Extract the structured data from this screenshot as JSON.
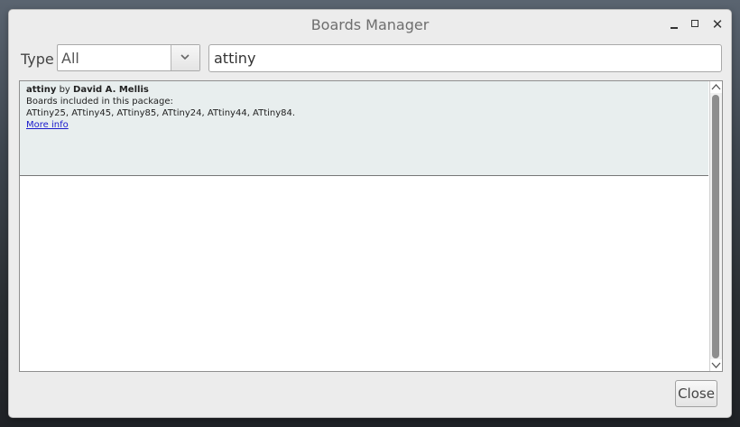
{
  "window": {
    "title": "Boards Manager"
  },
  "filter": {
    "type_label": "Type",
    "type_value": "All",
    "search_value": "attiny"
  },
  "results": [
    {
      "name": "attiny",
      "by_text": "by",
      "author": "David A. Mellis",
      "boards_heading": "Boards included in this package:",
      "boards": "ATtiny25, ATtiny45, ATtiny85, ATtiny24, ATtiny44, ATtiny84.",
      "more_info": "More info"
    }
  ],
  "footer": {
    "close_label": "Close"
  },
  "colors": {
    "list_item_bg": "#e8eeee",
    "link": "#1a1acc",
    "window_bg": "#ececec"
  }
}
